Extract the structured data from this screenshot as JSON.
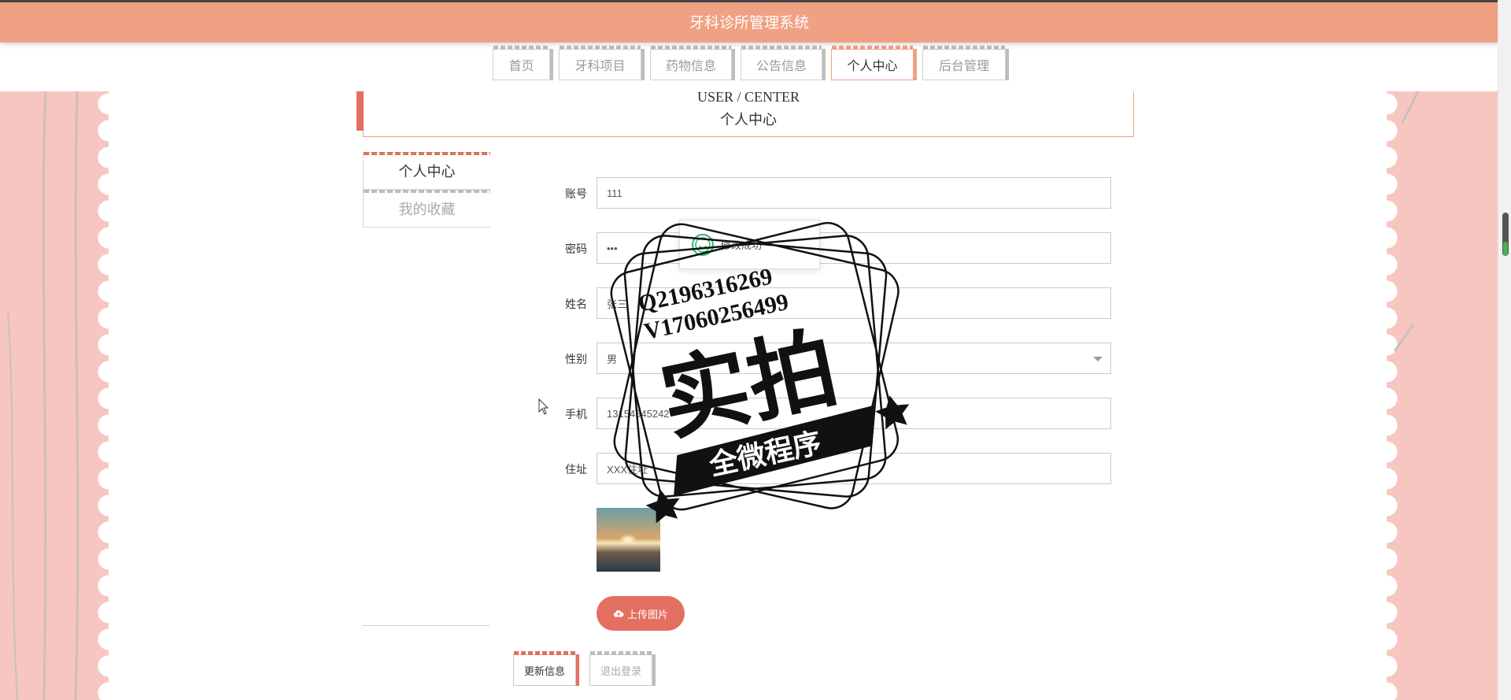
{
  "header": {
    "title": "牙科诊所管理系统"
  },
  "nav": {
    "tabs": [
      {
        "label": "首页",
        "active": false
      },
      {
        "label": "牙科项目",
        "active": false
      },
      {
        "label": "药物信息",
        "active": false
      },
      {
        "label": "公告信息",
        "active": false
      },
      {
        "label": "个人中心",
        "active": true
      },
      {
        "label": "后台管理",
        "active": false
      }
    ]
  },
  "page": {
    "title_en": "USER / CENTER",
    "title_cn": "个人中心"
  },
  "side_menu": {
    "items": [
      {
        "label": "个人中心",
        "active": true
      },
      {
        "label": "我的收藏",
        "active": false
      }
    ]
  },
  "form": {
    "account_label": "账号",
    "account_value": "111",
    "password_label": "密码",
    "password_value": "•••",
    "name_label": "姓名",
    "name_value": "张三",
    "gender_label": "性别",
    "gender_value": "男",
    "phone_label": "手机",
    "phone_value": "13154545242",
    "address_label": "住址",
    "address_value": "XXX住址",
    "upload_label": "上传图片",
    "update_button": "更新信息",
    "logout_button": "退出登录"
  },
  "toast": {
    "message": "修改成功"
  },
  "watermark": {
    "line1": "Q2196316269",
    "line2": "V17060256499",
    "big": "实拍",
    "banner": "全微程序"
  },
  "colors": {
    "accent": "#e36f60",
    "header": "#f0a183",
    "side_bg": "#f7c6c1"
  }
}
